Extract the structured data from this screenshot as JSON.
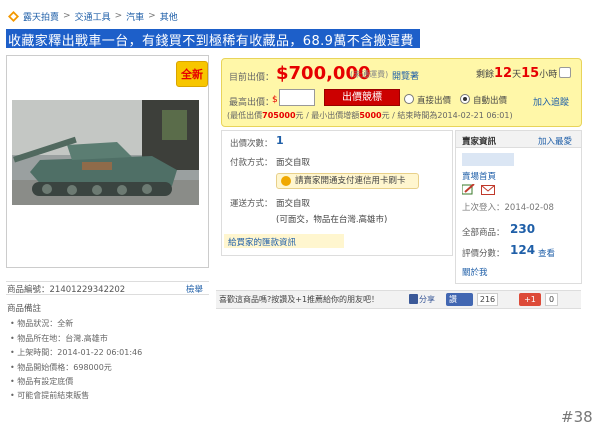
{
  "breadcrumb": [
    "露天拍賣",
    "交通工具",
    "汽車",
    "其他"
  ],
  "breadcrumb_sep": ">",
  "title": "收藏家釋出戰車一台，有錢買不到極稀有收藏品，68.9萬不含搬運費",
  "badge": "全新",
  "price": {
    "current_label": "目前出價：",
    "value": "$700,000",
    "shipping": "(未通運費)",
    "open_link": "開覽著",
    "countdown_prefix": "剩餘",
    "days": "12",
    "days_unit": "天",
    "hours": "15",
    "hours_unit": "小時"
  },
  "bid": {
    "max_label": "最高出價：",
    "currency": "$",
    "input_value": "",
    "button_label": "出價競標",
    "direct_label": "直接出價",
    "auto_label": "自動出價",
    "add_track": "加入追蹤",
    "note_prefix": "(最低出價",
    "min_bid": "705000",
    "note_mid": "元 / 最小出價增額",
    "increment": "5000",
    "note_suffix": "元 / 結束時間為2014-02-21 06:01)"
  },
  "details": {
    "bid_count_label": "出價次數：",
    "bid_count": "1",
    "pay_label": "付款方式：",
    "pay_value": "面交自取",
    "pay_promo": "請賣家開通支付連信用卡刷卡",
    "ship_label": "運送方式：",
    "ship_value": "面交自取",
    "ship_note": "(可面交，物品在台灣.高雄市)",
    "remit_link": "給買家的匯款資訊"
  },
  "seller": {
    "title": "賣家資訊",
    "fav": "加入最愛",
    "home": "賣場首頁",
    "last_login": "上次登入：2014-02-08",
    "total_label": "全部商品：",
    "total": "230",
    "rating_label": "評價分數：",
    "rating": "124",
    "rating_view": "查看",
    "about": "關於我"
  },
  "share": {
    "text": "喜歡這商品嗎?按讚及+1推薦給你的朋友吧！",
    "fb_share": "分享",
    "fb_like": "讚",
    "fb_count": "216",
    "gplus": "+1",
    "gplus_count": "0"
  },
  "item": {
    "id_text": "商品編號：21401229342202",
    "report": "檢舉",
    "notes_title": "商品備註",
    "notes": [
      "物品狀況：全新",
      "物品所在地：台灣.高雄市",
      "上架時間：2014-01-22 06:01:46",
      "物品開始價格：698000元",
      "物品有設定底價",
      "可能會提前結束販售"
    ]
  },
  "page_tag": "#38"
}
